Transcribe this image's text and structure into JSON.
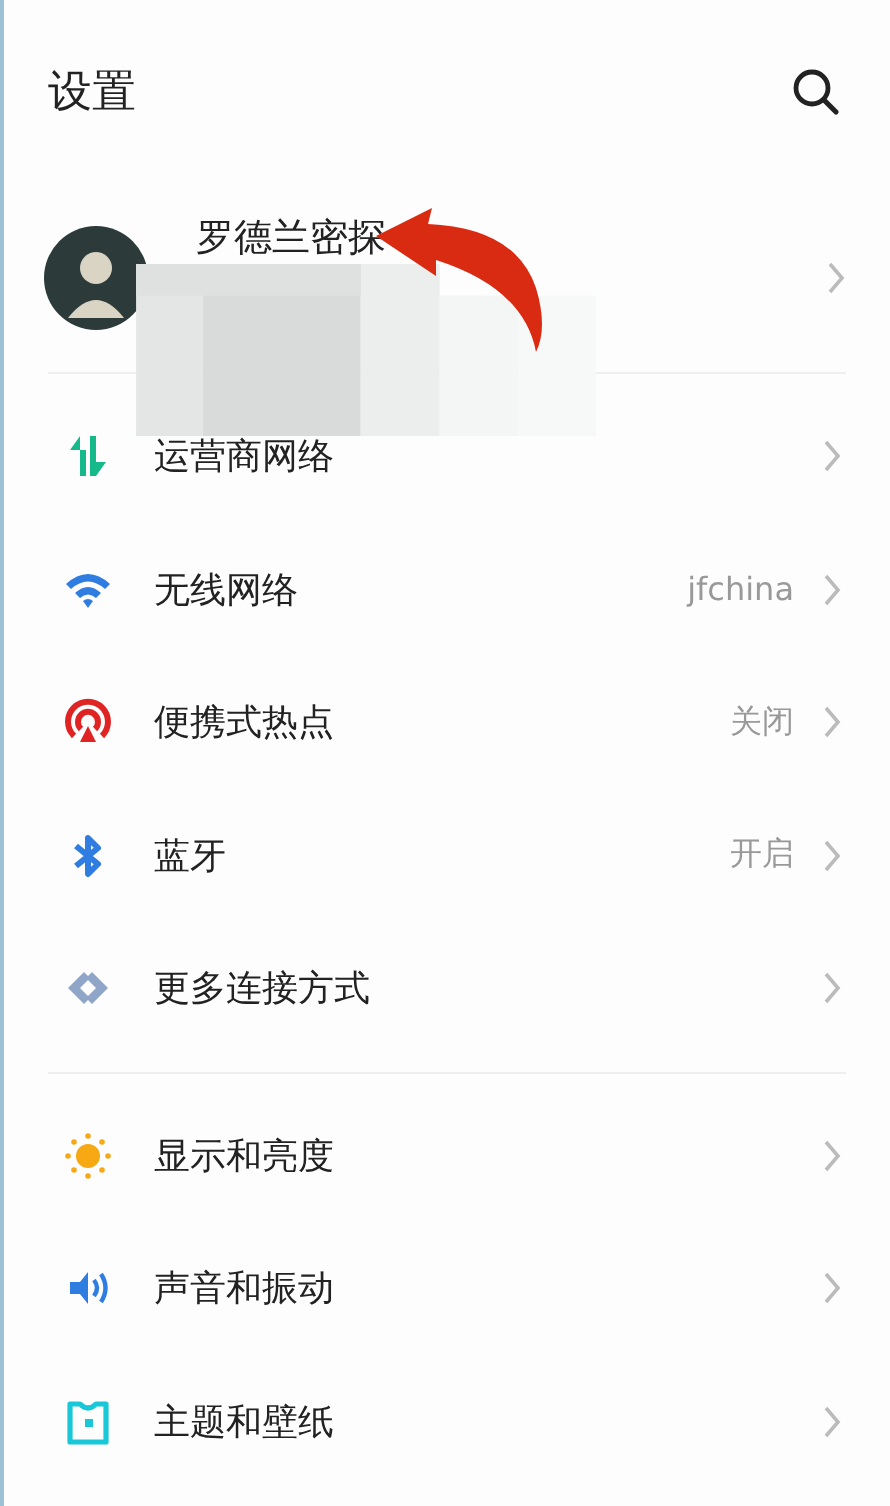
{
  "title": "设置",
  "profile": {
    "name": "罗德兰密探"
  },
  "groups": [
    {
      "items": [
        {
          "label": "运营商网络"
        },
        {
          "label": "无线网络",
          "value": "jfchina"
        },
        {
          "label": "便携式热点",
          "value": "关闭"
        },
        {
          "label": "蓝牙",
          "value": "开启"
        },
        {
          "label": "更多连接方式"
        }
      ]
    },
    {
      "items": [
        {
          "label": "显示和亮度"
        },
        {
          "label": "声音和振动"
        },
        {
          "label": "主题和壁纸"
        }
      ]
    }
  ]
}
